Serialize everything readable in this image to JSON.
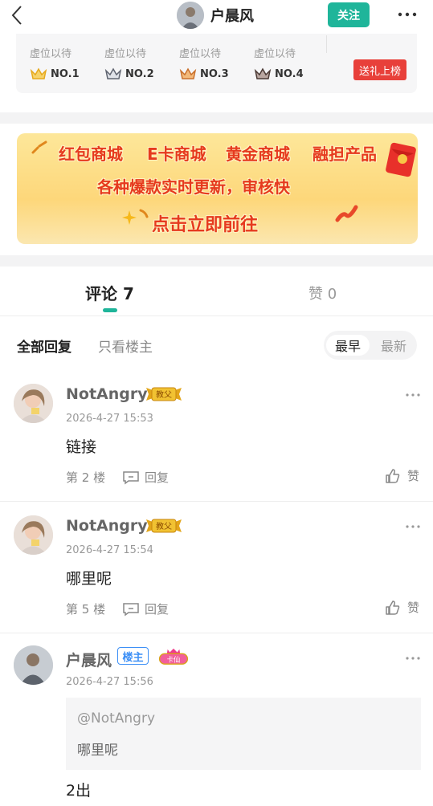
{
  "nav": {
    "title": "户晨风",
    "follow_label": "关注"
  },
  "ranking": {
    "items": [
      {
        "status": "虚位以待",
        "rank": "NO.1",
        "crown_color": "#e6a91e"
      },
      {
        "status": "虚位以待",
        "rank": "NO.2",
        "crown_color": "#5f6470"
      },
      {
        "status": "虚位以待",
        "rank": "NO.3",
        "crown_color": "#c9702c"
      },
      {
        "status": "虚位以待",
        "rank": "NO.4",
        "crown_color": "#4b3a35"
      }
    ],
    "gift_label": "送礼上榜"
  },
  "banner": {
    "line1": [
      "红包商城",
      "E卡商城",
      "黄金商城",
      "融担产品"
    ],
    "line2": "各种爆款实时更新，审核快",
    "line3": "点击立即前往"
  },
  "tabs": {
    "comments": "评论 7",
    "likes": "赞 0"
  },
  "filters": {
    "all": "全部回复",
    "host_only": "只看楼主",
    "sort_earliest": "最早",
    "sort_latest": "最新"
  },
  "comments": [
    {
      "user": "NotAngry",
      "badge": "教父",
      "time": "2026-4-27 15:53",
      "text": "链接",
      "floor": "第 2 楼",
      "reply": "回复",
      "like": "赞"
    },
    {
      "user": "NotAngry",
      "badge": "教父",
      "time": "2026-4-27 15:54",
      "text": "哪里呢",
      "floor": "第 5 楼",
      "reply": "回复",
      "like": "赞"
    },
    {
      "user": "户晨风",
      "host_badge": "楼主",
      "badge": "卡仙",
      "time": "2026-4-27 15:56",
      "quote_user": "@NotAngry",
      "quote_text": "哪里呢",
      "text": "2出"
    }
  ],
  "colors": {
    "accent": "#1fb59a",
    "gift": "#e8403a",
    "host_badge": "#3c8ff6"
  }
}
